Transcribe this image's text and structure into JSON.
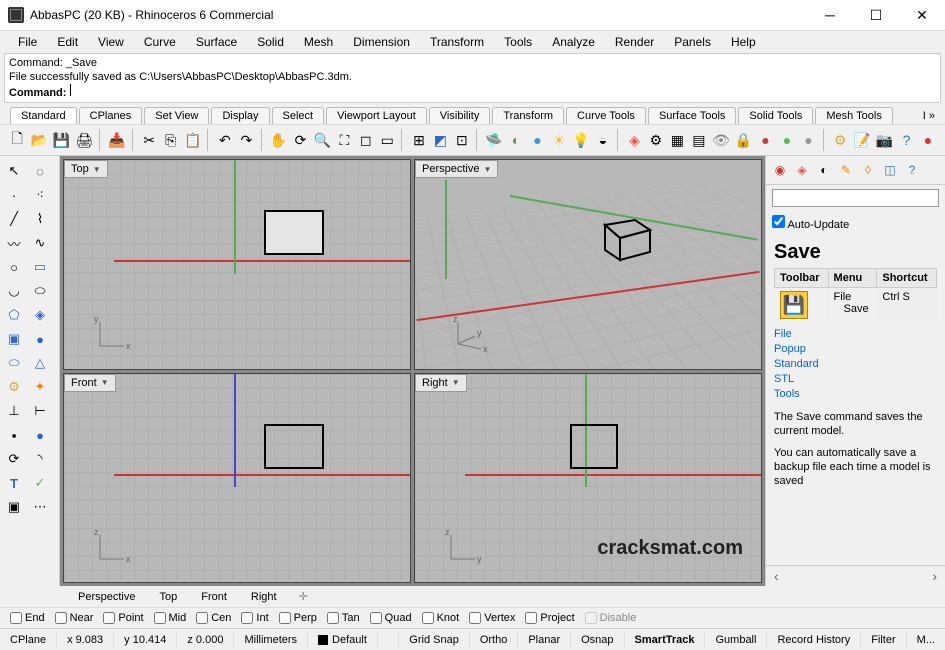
{
  "title": "AbbasPC (20 KB) - Rhinoceros 6 Commercial",
  "menu": [
    "File",
    "Edit",
    "View",
    "Curve",
    "Surface",
    "Solid",
    "Mesh",
    "Dimension",
    "Transform",
    "Tools",
    "Analyze",
    "Render",
    "Panels",
    "Help"
  ],
  "cmd": {
    "line1": "Command: _Save",
    "line2": "File successfully saved as C:\\Users\\AbbasPC\\Desktop\\AbbasPC.3dm.",
    "prompt": "Command:"
  },
  "tooltabs": [
    "Standard",
    "CPlanes",
    "Set View",
    "Display",
    "Select",
    "Viewport Layout",
    "Visibility",
    "Transform",
    "Curve Tools",
    "Surface Tools",
    "Solid Tools",
    "Mesh Tools"
  ],
  "tooltabs_overflow": "I »",
  "viewports": {
    "top": "Top",
    "perspective": "Perspective",
    "front": "Front",
    "right": "Right"
  },
  "watermark": "cracksmat.com",
  "rightpanel": {
    "auto_update": "Auto-Update",
    "heading": "Save",
    "cols": [
      "Toolbar",
      "Menu",
      "Shortcut"
    ],
    "menu_cell1": "File",
    "menu_cell2": "Save",
    "short_cell": "Ctrl S",
    "links": [
      "File",
      "Popup",
      "Standard",
      "STL",
      "Tools"
    ],
    "desc1": "The Save command saves the current model.",
    "desc2": "You can automatically save a backup file each time a model is saved"
  },
  "vptabs": [
    "Perspective",
    "Top",
    "Front",
    "Right"
  ],
  "osnaps": [
    "End",
    "Near",
    "Point",
    "Mid",
    "Cen",
    "Int",
    "Perp",
    "Tan",
    "Quad",
    "Knot",
    "Vertex",
    "Project",
    "Disable"
  ],
  "status": {
    "cplane": "CPlane",
    "x": "x 9.083",
    "y": "y 10.414",
    "z": "z 0.000",
    "units": "Millimeters",
    "layer": "Default",
    "right": [
      "Grid Snap",
      "Ortho",
      "Planar",
      "Osnap",
      "SmartTrack",
      "Gumball",
      "Record History",
      "Filter",
      "M..."
    ],
    "right_bold_idx": 4
  }
}
